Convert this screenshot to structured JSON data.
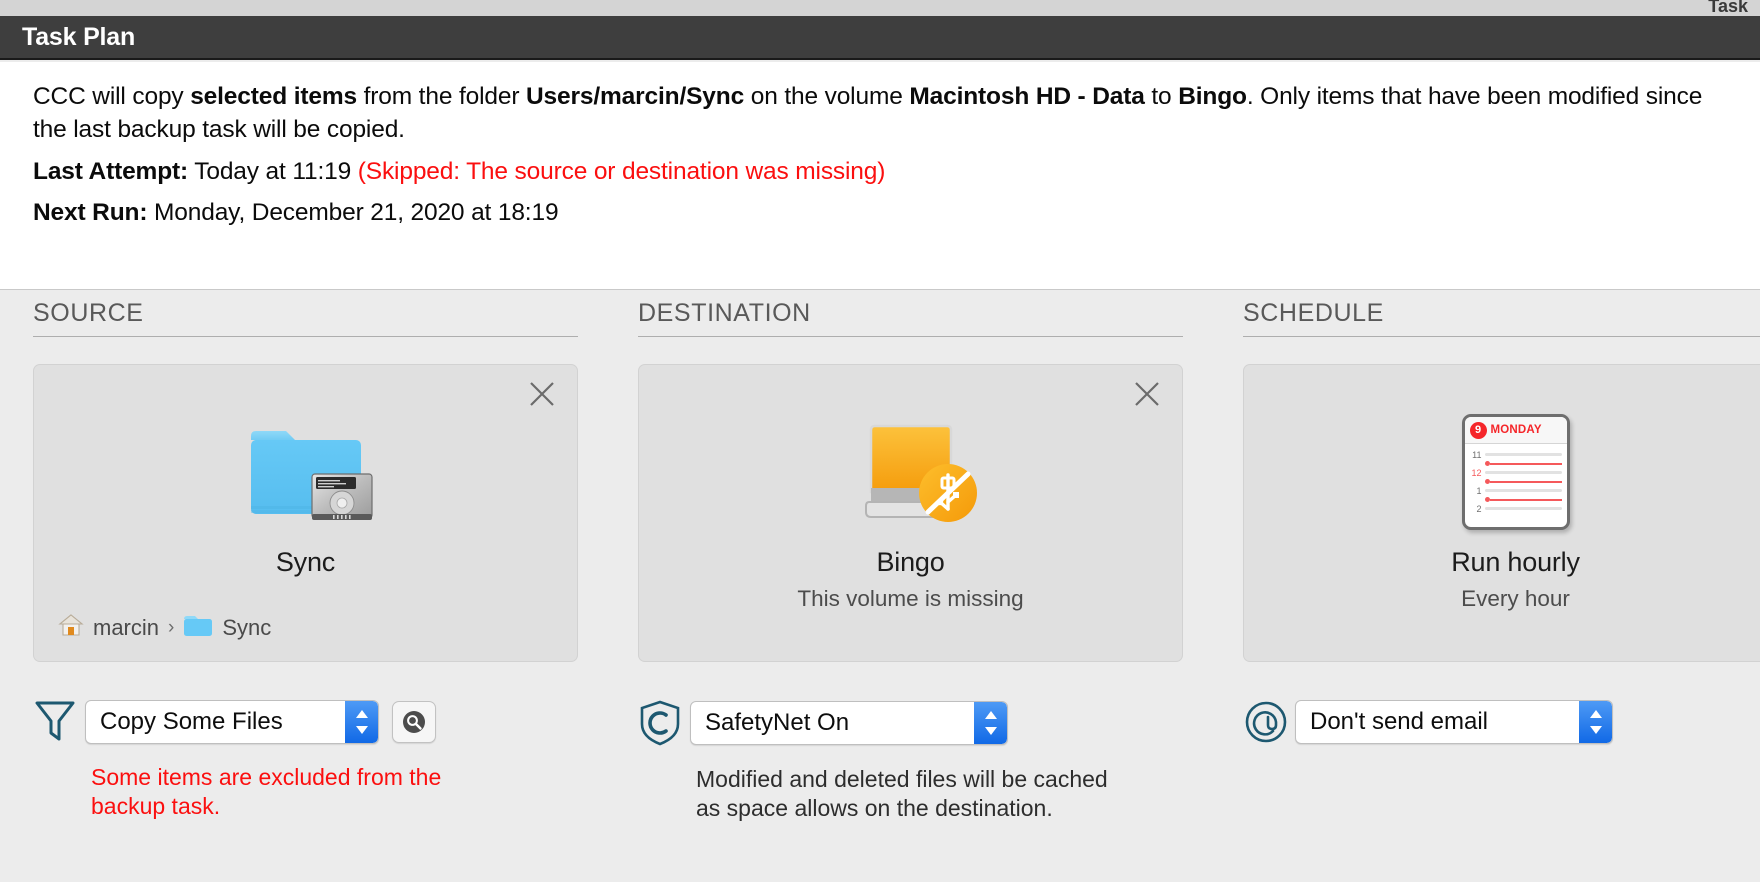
{
  "window": {
    "ghost_title": "Task"
  },
  "header": {
    "title": "Task Plan"
  },
  "summary": {
    "desc_1": "CCC will copy ",
    "desc_b1": "selected items",
    "desc_2": " from the folder ",
    "desc_b2": "Users/marcin/Sync",
    "desc_3": " on the volume ",
    "desc_b3": "Macintosh HD - Data",
    "desc_4": " to ",
    "desc_b4": "Bingo",
    "desc_5": ". Only items that have been modified since the last backup task will be copied.",
    "last_attempt_label": "Last Attempt:",
    "last_attempt_value": "Today at 11:19",
    "last_attempt_status": "(Skipped: The source or destination was missing)",
    "next_run_label": "Next Run:",
    "next_run_value": "Monday, December 21, 2020 at 18:19"
  },
  "source": {
    "section_title": "SOURCE",
    "close_icon": "close-icon",
    "icon": "folder-with-disk-icon",
    "name": "Sync",
    "breadcrumb": {
      "home_icon": "home-icon",
      "user": "marcin",
      "separator": "›",
      "folder_icon": "folder-icon",
      "folder": "Sync"
    },
    "control": {
      "icon": "filter-funnel-icon",
      "value": "Copy Some Files",
      "search_button_icon": "magnifier-icon"
    },
    "helper": "Some items are excluded from the backup task."
  },
  "destination": {
    "section_title": "DESTINATION",
    "close_icon": "close-icon",
    "icon": "external-drive-missing-icon",
    "name": "Bingo",
    "status": "This volume is missing",
    "control": {
      "icon": "safetynet-shield-icon",
      "value": "SafetyNet On"
    },
    "helper": "Modified and deleted files will be cached as space allows on the destination."
  },
  "schedule": {
    "section_title": "SCHEDULE",
    "icon": "calendar-icon",
    "calendar": {
      "day_number": "9",
      "day_name": "MONDAY",
      "hours": [
        "11",
        "12",
        "1",
        "2"
      ],
      "active_hour": "12"
    },
    "name": "Run hourly",
    "status": "Every hour",
    "control": {
      "icon": "at-sign-icon",
      "value": "Don't send email"
    }
  },
  "colors": {
    "titlebar_bg": "#3e3e3e",
    "page_bg": "#ececec",
    "panel_bg": "#ffffff",
    "card_bg": "#e0e0e0",
    "error_red": "#fb0f0f",
    "accent_blue": "#1169e6",
    "icon_teal": "#1d5870",
    "folder_blue": "#62c8f5",
    "drive_orange": "#f7a81b",
    "calendar_red": "#f5262a"
  }
}
